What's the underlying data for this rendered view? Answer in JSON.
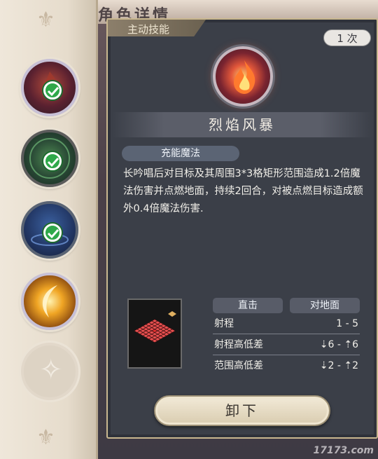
{
  "header": {
    "title": "角色详情"
  },
  "rail": {
    "skills": [
      {
        "name": "skill-fire",
        "equipped": true
      },
      {
        "name": "skill-nature",
        "equipped": true
      },
      {
        "name": "skill-arcane",
        "equipped": true
      },
      {
        "name": "skill-light",
        "equipped": false
      },
      {
        "name": "skill-locked",
        "equipped": false
      }
    ]
  },
  "panel": {
    "tab": "主动技能",
    "count": "1 次",
    "skill_name": "烈焰风暴",
    "skill_type": "充能魔法",
    "description": "长吟唱后对目标及其周围3*3格矩形范围造成1.2倍魔法伤害并点燃地面，持续2回合，对被点燃目标造成额外0.4倍魔法伤害.",
    "stats": {
      "headers": [
        "直击",
        "对地面"
      ],
      "rows": [
        {
          "label": "射程",
          "value": "1 - 5"
        },
        {
          "label": "射程高低差",
          "value": "⇣6 - ⇡6"
        },
        {
          "label": "范围高低差",
          "value": "⇣2 - ⇡2"
        }
      ]
    },
    "unload_label": "卸下"
  },
  "watermark": "17173.com",
  "colors": {
    "accent": "#c9b78f",
    "panel": "#3b3f48",
    "check": "#2fa84a"
  }
}
